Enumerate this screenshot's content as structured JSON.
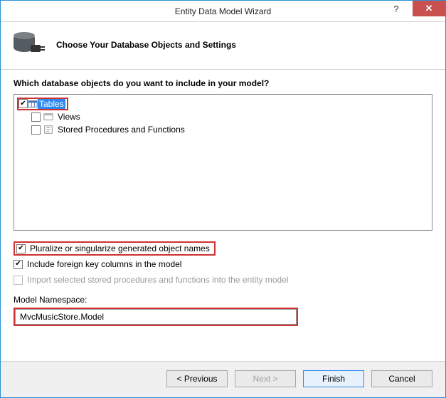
{
  "window": {
    "title": "Entity Data Model Wizard",
    "help_glyph": "?",
    "close_glyph": "✕"
  },
  "header": {
    "title": "Choose Your Database Objects and Settings"
  },
  "prompt": "Which database objects do you want to include in your model?",
  "tree": {
    "items": [
      {
        "label": "Tables",
        "checked": true,
        "selected": true
      },
      {
        "label": "Views",
        "checked": false,
        "selected": false
      },
      {
        "label": "Stored Procedures and Functions",
        "checked": false,
        "selected": false
      }
    ]
  },
  "options": {
    "pluralize": {
      "label": "Pluralize or singularize generated object names",
      "checked": true
    },
    "foreign_keys": {
      "label": "Include foreign key columns in the model",
      "checked": true
    },
    "import_sprocs": {
      "label": "Import selected stored procedures and functions into the entity model",
      "checked": false,
      "disabled": true
    }
  },
  "namespace": {
    "label": "Model Namespace:",
    "value": "MvcMusicStore.Model"
  },
  "buttons": {
    "previous": "< Previous",
    "next": "Next >",
    "finish": "Finish",
    "cancel": "Cancel"
  }
}
